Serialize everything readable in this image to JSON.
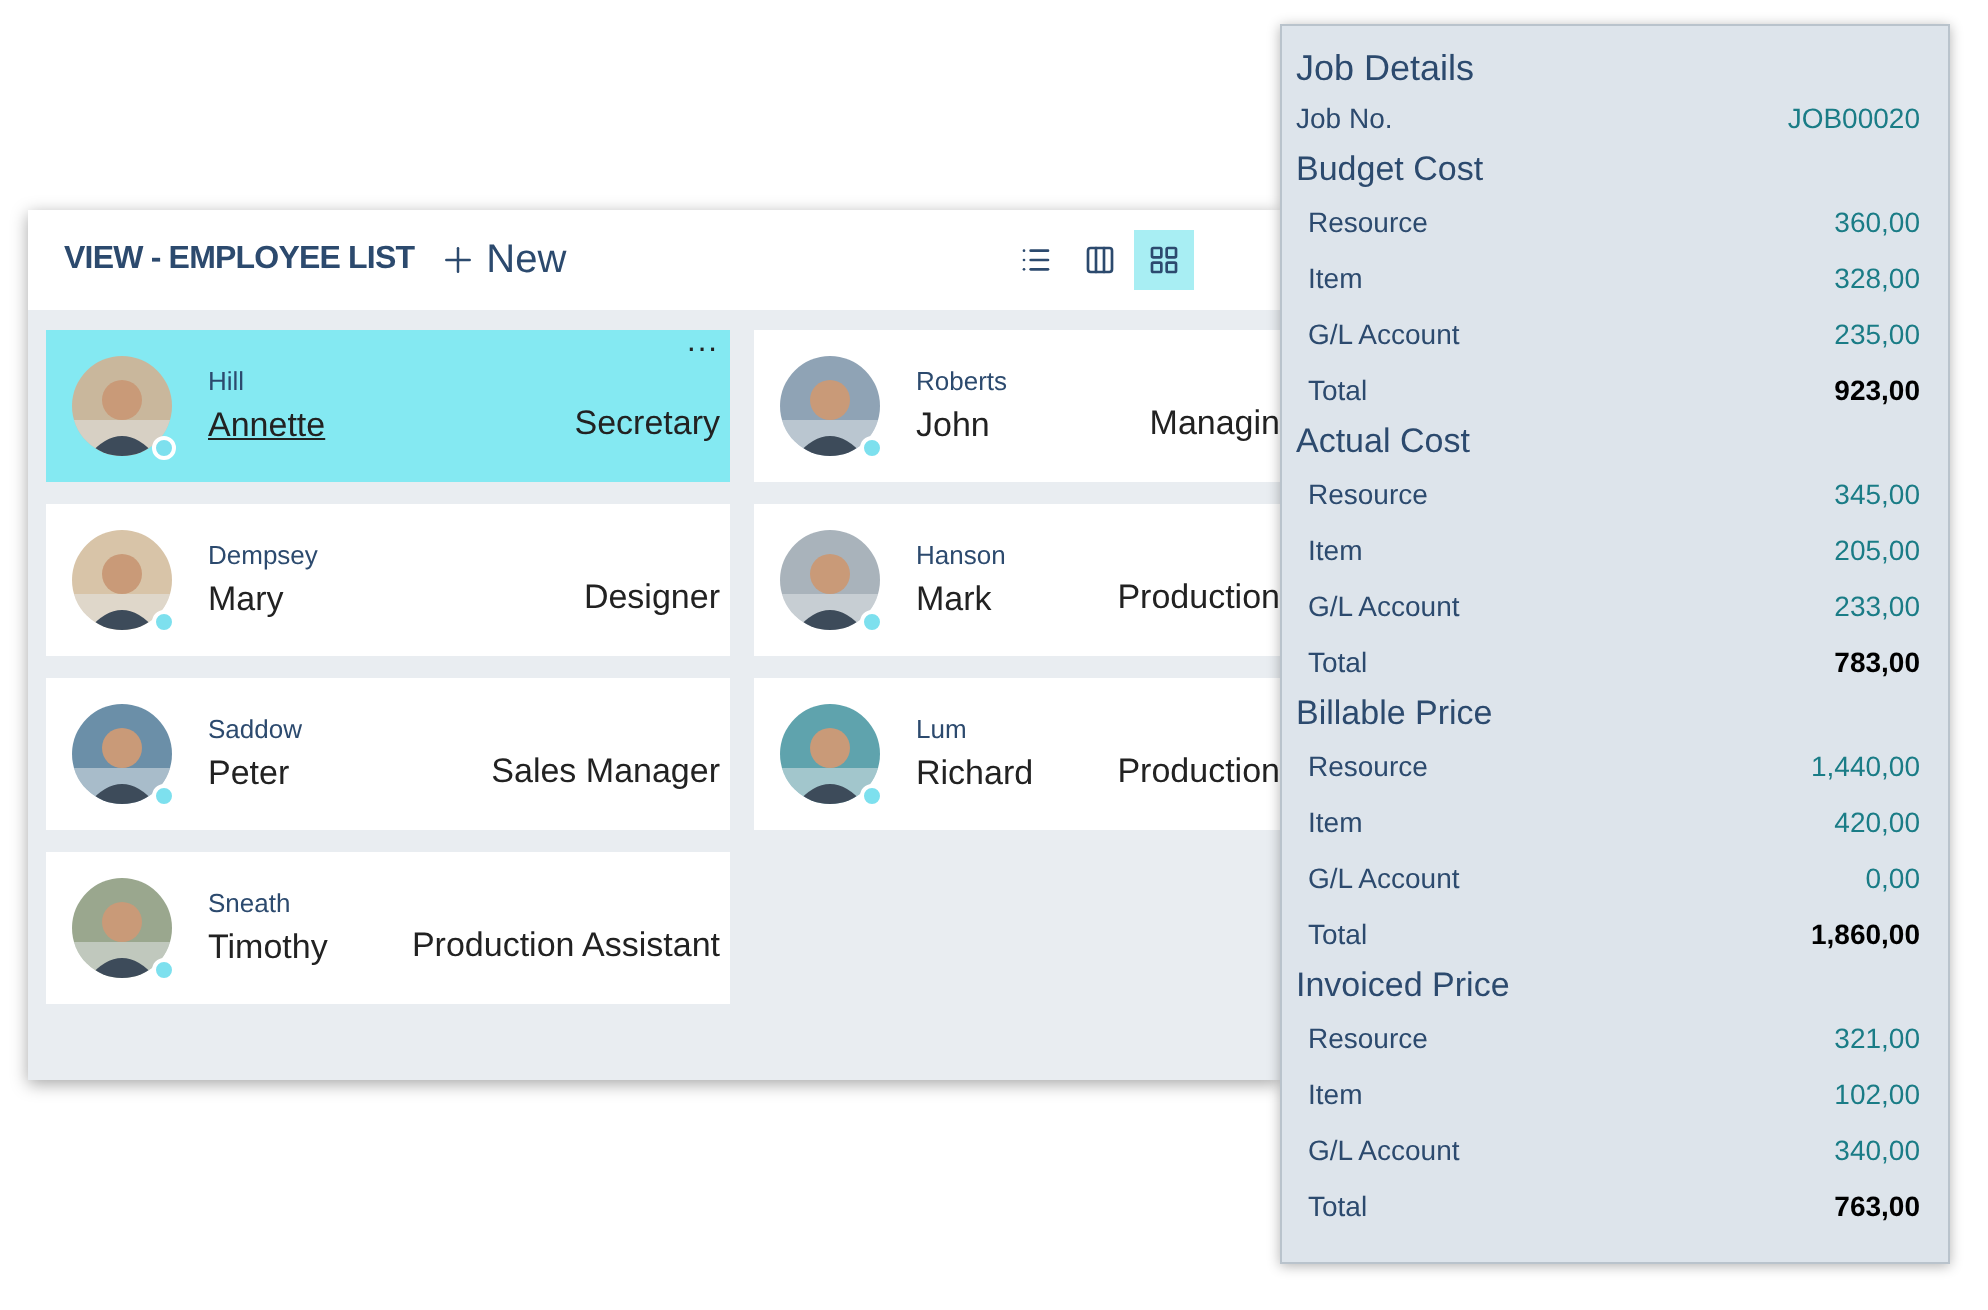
{
  "list": {
    "title": "VIEW - EMPLOYEE LIST",
    "new_label": "New",
    "views": [
      {
        "kind": "list",
        "selected": false
      },
      {
        "kind": "tile",
        "selected": false
      },
      {
        "kind": "grid",
        "selected": true
      }
    ],
    "menu_glyph": "···"
  },
  "employees": [
    {
      "last": "Hill",
      "first": "Annette",
      "job": "Secretary",
      "selected": true
    },
    {
      "last": "Roberts",
      "first": "John",
      "job": "Managin",
      "selected": false
    },
    {
      "last": "Dempsey",
      "first": "Mary",
      "job": "Designer",
      "selected": false
    },
    {
      "last": "Hanson",
      "first": "Mark",
      "job": "Production",
      "selected": false
    },
    {
      "last": "Saddow",
      "first": "Peter",
      "job": "Sales Manager",
      "selected": false
    },
    {
      "last": "Lum",
      "first": "Richard",
      "job": "Production",
      "selected": false
    },
    {
      "last": "Sneath",
      "first": "Timothy",
      "job": "Production Assistant",
      "selected": false
    }
  ],
  "details": {
    "title": "Job Details",
    "job_no": {
      "label": "Job No.",
      "value": "JOB00020"
    },
    "groups": [
      {
        "title": "Budget Cost",
        "rows": [
          {
            "label": "Resource",
            "value": "360,00"
          },
          {
            "label": "Item",
            "value": "328,00"
          },
          {
            "label": "G/L Account",
            "value": "235,00"
          }
        ],
        "total": {
          "label": "Total",
          "value": "923,00"
        }
      },
      {
        "title": "Actual Cost",
        "rows": [
          {
            "label": "Resource",
            "value": "345,00"
          },
          {
            "label": "Item",
            "value": "205,00"
          },
          {
            "label": "G/L Account",
            "value": "233,00"
          }
        ],
        "total": {
          "label": "Total",
          "value": "783,00"
        }
      },
      {
        "title": "Billable Price",
        "rows": [
          {
            "label": "Resource",
            "value": "1,440,00"
          },
          {
            "label": "Item",
            "value": "420,00"
          },
          {
            "label": "G/L Account",
            "value": "0,00"
          }
        ],
        "total": {
          "label": "Total",
          "value": "1,860,00"
        }
      },
      {
        "title": "Invoiced Price",
        "rows": [
          {
            "label": "Resource",
            "value": "321,00"
          },
          {
            "label": "Item",
            "value": "102,00"
          },
          {
            "label": "G/L Account",
            "value": "340,00"
          }
        ],
        "total": {
          "label": "Total",
          "value": "763,00"
        }
      }
    ]
  }
}
